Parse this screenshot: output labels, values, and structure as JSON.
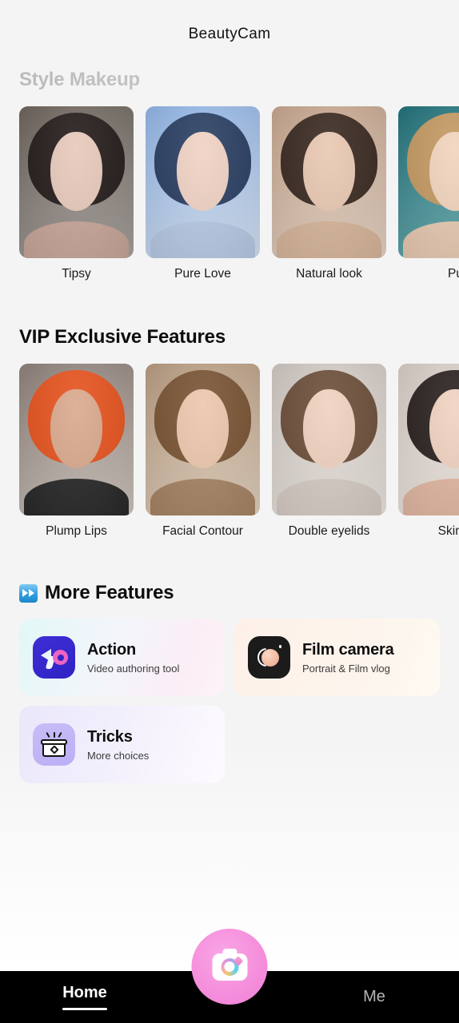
{
  "app": {
    "title": "BeautyCam",
    "background_top": "#f4f4f4",
    "background_bottom": "#ffffff"
  },
  "style_makeup": {
    "heading": "Style Makeup",
    "items": [
      {
        "label": "Tipsy",
        "c1": "#6b6259",
        "c2": "#a9a3a0",
        "hair": "#241c1a",
        "face": "#e7c9bb",
        "body": "#c9a79b"
      },
      {
        "label": "Pure Love",
        "c1": "#8fb4e6",
        "c2": "#d7e4f5",
        "hair": "#2b3f63",
        "face": "#f0d2c4",
        "body": "#b9cbe6"
      },
      {
        "label": "Natural look",
        "c1": "#c6a48c",
        "c2": "#e6d4c4",
        "hair": "#3a2a21",
        "face": "#e9c8b2",
        "body": "#d8b79c"
      },
      {
        "label": "Pu",
        "c1": "#1f6f78",
        "c2": "#6fb3b6",
        "hair": "#c49a62",
        "face": "#f2d4bd",
        "body": "#e8cbb2"
      }
    ]
  },
  "vip_features": {
    "heading": "VIP Exclusive Features",
    "items": [
      {
        "label": "Plump Lips",
        "c1": "#8c7f77",
        "c2": "#cfc6bf",
        "hair": "#e7531f",
        "face": "#d9a98c",
        "body": "#2a2a2a"
      },
      {
        "label": "Facial Contour",
        "c1": "#b79a7f",
        "c2": "#e3d2bf",
        "hair": "#7a5434",
        "face": "#ecc7ad",
        "body": "#a88566"
      },
      {
        "label": "Double eyelids",
        "c1": "#cfc7c1",
        "c2": "#ece6e1",
        "hair": "#6d4f3a",
        "face": "#f0d2c0",
        "body": "#d8cdc6"
      },
      {
        "label": "Skin T",
        "c1": "#d8cdc6",
        "c2": "#efe8e3",
        "hair": "#2b2220",
        "face": "#f1d3c0",
        "body": "#e3b8a3"
      }
    ]
  },
  "more_features": {
    "heading": "More Features",
    "heading_icon": "fast-forward-icon",
    "tiles": [
      {
        "title": "Action",
        "subtitle": "Video authoring tool",
        "icon": "action-icon"
      },
      {
        "title": "Film camera",
        "subtitle": "Portrait & Film vlog",
        "icon": "film-camera-icon"
      },
      {
        "title": "Tricks",
        "subtitle": "More choices",
        "icon": "tricks-icon"
      }
    ]
  },
  "bottom_nav": {
    "items": [
      {
        "label": "Home",
        "active": true
      },
      {
        "label": "Me",
        "active": false
      }
    ],
    "camera_button": "camera-shutter-icon",
    "accent_color": "#f58fdc",
    "bar_color": "#000000"
  }
}
